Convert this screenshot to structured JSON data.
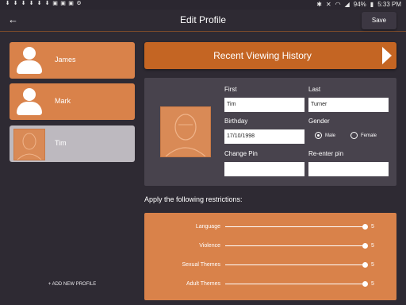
{
  "statusbar": {
    "battery": "94%",
    "time": "5:33 PM"
  },
  "header": {
    "title": "Edit Profile",
    "save_label": "Save"
  },
  "profiles": [
    {
      "name": "James",
      "selected": false
    },
    {
      "name": "Mark",
      "selected": false
    },
    {
      "name": "Tim",
      "selected": true
    }
  ],
  "add_profile_label": "+ ADD NEW PROFILE",
  "recent_viewing_history_label": "Recent Viewing History",
  "form": {
    "first_label": "First",
    "first_value": "Tim",
    "last_label": "Last",
    "last_value": "Turner",
    "birthday_label": "Birthday",
    "birthday_value": "17/10/1998",
    "gender_label": "Gender",
    "gender_options": [
      "Male",
      "Female"
    ],
    "gender_selected": "Male",
    "change_pin_label": "Change Pin",
    "reenter_pin_label": "Re-enter pin"
  },
  "restrictions": {
    "heading": "Apply the following restrictions:",
    "max": 5,
    "items": [
      {
        "name": "Language",
        "value": 5
      },
      {
        "name": "Violence",
        "value": 5
      },
      {
        "name": "Sexual Themes",
        "value": 5
      },
      {
        "name": "Adult Themes",
        "value": 5
      }
    ]
  },
  "colors": {
    "accent": "#d9824a",
    "accent_dark": "#c46523",
    "background": "#2e2a33",
    "panel": "#48434d"
  }
}
